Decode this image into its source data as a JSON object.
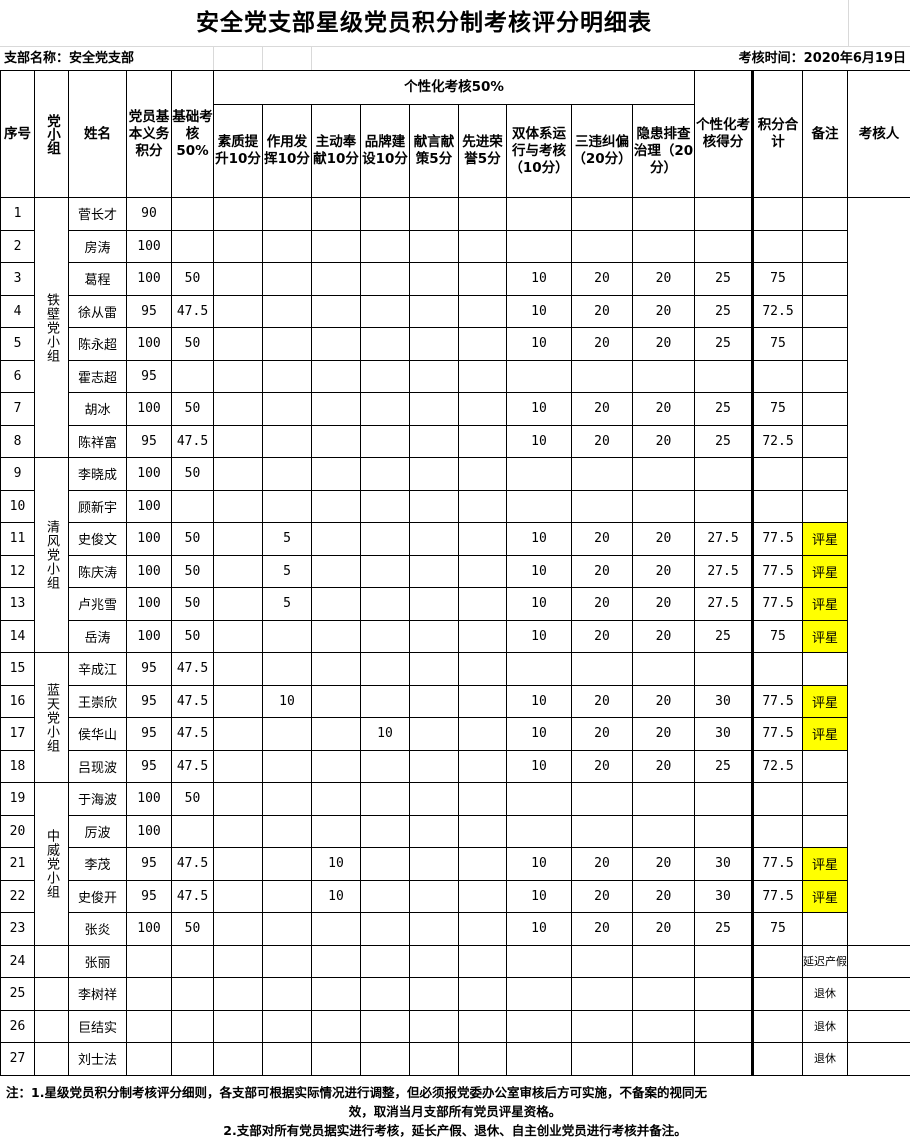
{
  "title": "安全党支部星级党员积分制考核评分明细表",
  "branch_label": "支部名称：安全党支部",
  "date_label": "考核时间：2020年6月19日",
  "header": {
    "seq": "序号",
    "group": "党小组",
    "name": "姓名",
    "basic_duty": "党员基本义务积分",
    "basic_assess": "基础考核50%",
    "personal_group": "个性化考核50%",
    "quality": "素质提升10分",
    "role": "作用发挥10分",
    "contribution": "主动奉献10分",
    "brand": "品牌建设10分",
    "advice": "献言献策5分",
    "honor": "先进荣誉5分",
    "dual_system": "双体系运行与考核（10分）",
    "three_violations": "三违纠偏（20分）",
    "hazard": "隐患排查治理（20分）",
    "personal_score": "个性化考核得分",
    "total": "积分合计",
    "remark": "备注",
    "assessor": "考核人"
  },
  "groups": [
    {
      "name": "铁壁党小组",
      "start": 0,
      "span": 8
    },
    {
      "name": "清风党小组",
      "start": 8,
      "span": 6
    },
    {
      "name": "蓝天党小组",
      "start": 14,
      "span": 4
    },
    {
      "name": "中威党小组",
      "start": 18,
      "span": 5
    },
    {
      "name": "",
      "start": 23,
      "span": 1
    },
    {
      "name": "",
      "start": 24,
      "span": 1
    },
    {
      "name": "",
      "start": 25,
      "span": 1
    },
    {
      "name": "",
      "start": 26,
      "span": 1
    }
  ],
  "rows": [
    {
      "seq": "1",
      "name": "菅长才",
      "duty": "90",
      "basic": "",
      "quality": "",
      "role": "",
      "contrib": "",
      "brand": "",
      "advice": "",
      "honor": "",
      "dual": "",
      "three": "",
      "hazard": "",
      "pscore": "",
      "total": "",
      "remark": ""
    },
    {
      "seq": "2",
      "name": "房涛",
      "duty": "100",
      "basic": "",
      "quality": "",
      "role": "",
      "contrib": "",
      "brand": "",
      "advice": "",
      "honor": "",
      "dual": "",
      "three": "",
      "hazard": "",
      "pscore": "",
      "total": "",
      "remark": ""
    },
    {
      "seq": "3",
      "name": "葛程",
      "duty": "100",
      "basic": "50",
      "quality": "",
      "role": "",
      "contrib": "",
      "brand": "",
      "advice": "",
      "honor": "",
      "dual": "10",
      "three": "20",
      "hazard": "20",
      "pscore": "25",
      "total": "75",
      "remark": ""
    },
    {
      "seq": "4",
      "name": "徐从雷",
      "duty": "95",
      "basic": "47.5",
      "quality": "",
      "role": "",
      "contrib": "",
      "brand": "",
      "advice": "",
      "honor": "",
      "dual": "10",
      "three": "20",
      "hazard": "20",
      "pscore": "25",
      "total": "72.5",
      "remark": ""
    },
    {
      "seq": "5",
      "name": "陈永超",
      "duty": "100",
      "basic": "50",
      "quality": "",
      "role": "",
      "contrib": "",
      "brand": "",
      "advice": "",
      "honor": "",
      "dual": "10",
      "three": "20",
      "hazard": "20",
      "pscore": "25",
      "total": "75",
      "remark": ""
    },
    {
      "seq": "6",
      "name": "霍志超",
      "duty": "95",
      "basic": "",
      "quality": "",
      "role": "",
      "contrib": "",
      "brand": "",
      "advice": "",
      "honor": "",
      "dual": "",
      "three": "",
      "hazard": "",
      "pscore": "",
      "total": "",
      "remark": ""
    },
    {
      "seq": "7",
      "name": "胡冰",
      "duty": "100",
      "basic": "50",
      "quality": "",
      "role": "",
      "contrib": "",
      "brand": "",
      "advice": "",
      "honor": "",
      "dual": "10",
      "three": "20",
      "hazard": "20",
      "pscore": "25",
      "total": "75",
      "remark": ""
    },
    {
      "seq": "8",
      "name": "陈祥富",
      "duty": "95",
      "basic": "47.5",
      "quality": "",
      "role": "",
      "contrib": "",
      "brand": "",
      "advice": "",
      "honor": "",
      "dual": "10",
      "three": "20",
      "hazard": "20",
      "pscore": "25",
      "total": "72.5",
      "remark": ""
    },
    {
      "seq": "9",
      "name": "李晓成",
      "duty": "100",
      "basic": "50",
      "quality": "",
      "role": "",
      "contrib": "",
      "brand": "",
      "advice": "",
      "honor": "",
      "dual": "",
      "three": "",
      "hazard": "",
      "pscore": "",
      "total": "",
      "remark": ""
    },
    {
      "seq": "10",
      "name": "顾新宇",
      "duty": "100",
      "basic": "",
      "quality": "",
      "role": "",
      "contrib": "",
      "brand": "",
      "advice": "",
      "honor": "",
      "dual": "",
      "three": "",
      "hazard": "",
      "pscore": "",
      "total": "",
      "remark": ""
    },
    {
      "seq": "11",
      "name": "史俊文",
      "duty": "100",
      "basic": "50",
      "quality": "",
      "role": "5",
      "contrib": "",
      "brand": "",
      "advice": "",
      "honor": "",
      "dual": "10",
      "three": "20",
      "hazard": "20",
      "pscore": "27.5",
      "total": "77.5",
      "remark": "评星"
    },
    {
      "seq": "12",
      "name": "陈庆涛",
      "duty": "100",
      "basic": "50",
      "quality": "",
      "role": "5",
      "contrib": "",
      "brand": "",
      "advice": "",
      "honor": "",
      "dual": "10",
      "three": "20",
      "hazard": "20",
      "pscore": "27.5",
      "total": "77.5",
      "remark": "评星"
    },
    {
      "seq": "13",
      "name": "卢兆雪",
      "duty": "100",
      "basic": "50",
      "quality": "",
      "role": "5",
      "contrib": "",
      "brand": "",
      "advice": "",
      "honor": "",
      "dual": "10",
      "three": "20",
      "hazard": "20",
      "pscore": "27.5",
      "total": "77.5",
      "remark": "评星"
    },
    {
      "seq": "14",
      "name": "岳涛",
      "duty": "100",
      "basic": "50",
      "quality": "",
      "role": "",
      "contrib": "",
      "brand": "",
      "advice": "",
      "honor": "",
      "dual": "10",
      "three": "20",
      "hazard": "20",
      "pscore": "25",
      "total": "75",
      "remark": "评星"
    },
    {
      "seq": "15",
      "name": "辛成江",
      "duty": "95",
      "basic": "47.5",
      "quality": "",
      "role": "",
      "contrib": "",
      "brand": "",
      "advice": "",
      "honor": "",
      "dual": "",
      "three": "",
      "hazard": "",
      "pscore": "",
      "total": "",
      "remark": ""
    },
    {
      "seq": "16",
      "name": "王崇欣",
      "duty": "95",
      "basic": "47.5",
      "quality": "",
      "role": "10",
      "contrib": "",
      "brand": "",
      "advice": "",
      "honor": "",
      "dual": "10",
      "three": "20",
      "hazard": "20",
      "pscore": "30",
      "total": "77.5",
      "remark": "评星"
    },
    {
      "seq": "17",
      "name": "侯华山",
      "duty": "95",
      "basic": "47.5",
      "quality": "",
      "role": "",
      "contrib": "",
      "brand": "10",
      "advice": "",
      "honor": "",
      "dual": "10",
      "three": "20",
      "hazard": "20",
      "pscore": "30",
      "total": "77.5",
      "remark": "评星"
    },
    {
      "seq": "18",
      "name": "吕现波",
      "duty": "95",
      "basic": "47.5",
      "quality": "",
      "role": "",
      "contrib": "",
      "brand": "",
      "advice": "",
      "honor": "",
      "dual": "10",
      "three": "20",
      "hazard": "20",
      "pscore": "25",
      "total": "72.5",
      "remark": ""
    },
    {
      "seq": "19",
      "name": "于海波",
      "duty": "100",
      "basic": "50",
      "quality": "",
      "role": "",
      "contrib": "",
      "brand": "",
      "advice": "",
      "honor": "",
      "dual": "",
      "three": "",
      "hazard": "",
      "pscore": "",
      "total": "",
      "remark": ""
    },
    {
      "seq": "20",
      "name": "厉波",
      "duty": "100",
      "basic": "",
      "quality": "",
      "role": "",
      "contrib": "",
      "brand": "",
      "advice": "",
      "honor": "",
      "dual": "",
      "three": "",
      "hazard": "",
      "pscore": "",
      "total": "",
      "remark": ""
    },
    {
      "seq": "21",
      "name": "李茂",
      "duty": "95",
      "basic": "47.5",
      "quality": "",
      "role": "",
      "contrib": "10",
      "brand": "",
      "advice": "",
      "honor": "",
      "dual": "10",
      "three": "20",
      "hazard": "20",
      "pscore": "30",
      "total": "77.5",
      "remark": "评星"
    },
    {
      "seq": "22",
      "name": "史俊开",
      "duty": "95",
      "basic": "47.5",
      "quality": "",
      "role": "",
      "contrib": "10",
      "brand": "",
      "advice": "",
      "honor": "",
      "dual": "10",
      "three": "20",
      "hazard": "20",
      "pscore": "30",
      "total": "77.5",
      "remark": "评星"
    },
    {
      "seq": "23",
      "name": "张炎",
      "duty": "100",
      "basic": "50",
      "quality": "",
      "role": "",
      "contrib": "",
      "brand": "",
      "advice": "",
      "honor": "",
      "dual": "10",
      "three": "20",
      "hazard": "20",
      "pscore": "25",
      "total": "75",
      "remark": ""
    },
    {
      "seq": "24",
      "name": "张丽",
      "duty": "",
      "basic": "",
      "quality": "",
      "role": "",
      "contrib": "",
      "brand": "",
      "advice": "",
      "honor": "",
      "dual": "",
      "three": "",
      "hazard": "",
      "pscore": "",
      "total": "",
      "remark": "延迟产假"
    },
    {
      "seq": "25",
      "name": "李树祥",
      "duty": "",
      "basic": "",
      "quality": "",
      "role": "",
      "contrib": "",
      "brand": "",
      "advice": "",
      "honor": "",
      "dual": "",
      "three": "",
      "hazard": "",
      "pscore": "",
      "total": "",
      "remark": "退休"
    },
    {
      "seq": "26",
      "name": "巨结实",
      "duty": "",
      "basic": "",
      "quality": "",
      "role": "",
      "contrib": "",
      "brand": "",
      "advice": "",
      "honor": "",
      "dual": "",
      "three": "",
      "hazard": "",
      "pscore": "",
      "total": "",
      "remark": "退休"
    },
    {
      "seq": "27",
      "name": "刘士法",
      "duty": "",
      "basic": "",
      "quality": "",
      "role": "",
      "contrib": "",
      "brand": "",
      "advice": "",
      "honor": "",
      "dual": "",
      "three": "",
      "hazard": "",
      "pscore": "",
      "total": "",
      "remark": "退休"
    }
  ],
  "assessor_merge_rows": 23,
  "highlight_color": "#ffff00",
  "star_label": "评星",
  "footer": {
    "line1": "注：1.星级党员积分制考核评分细则，各支部可根据实际情况进行调整，但必须报党委办公室审核后方可实施，不备案的视同无",
    "line2": "效，取消当月支部所有党员评星资格。",
    "line3": "2.支部对所有党员据实进行考核，延长产假、退休、自主创业党员进行考核并备注。"
  }
}
